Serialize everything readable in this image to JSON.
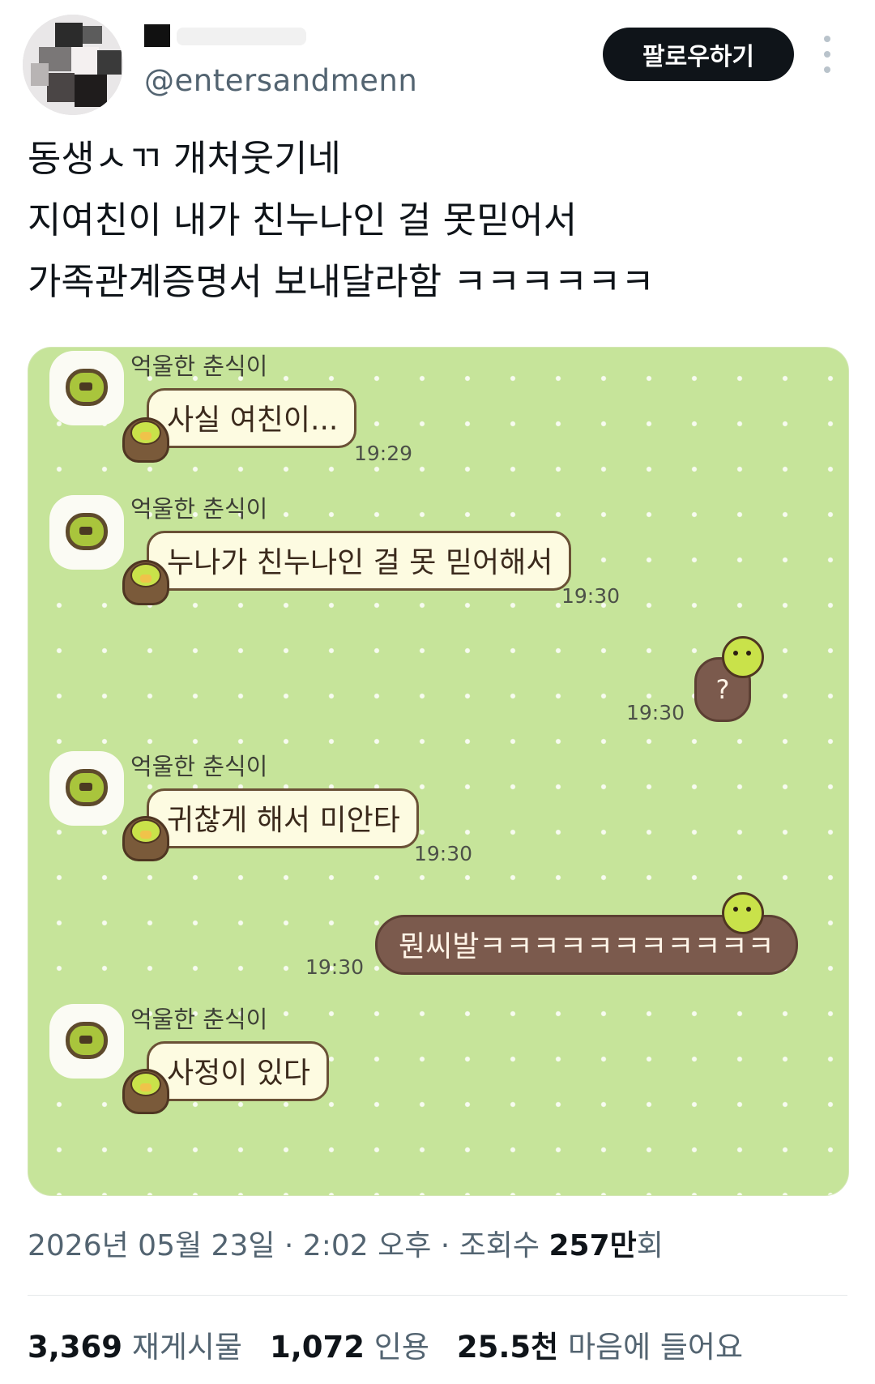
{
  "header": {
    "handle": "@entersandmenn",
    "follow_label": "팔로우하기"
  },
  "tweet": {
    "lines": [
      "동생ㅅㄲ 개처웃기네",
      "지여친이 내가 친누나인 걸 못믿어서",
      "가족관계증명서 보내달라함 ㅋㅋㅋㅋㅋㅋ"
    ]
  },
  "chat": {
    "messages": [
      {
        "sender": "억울한 춘식이",
        "text": "사실 여친이...",
        "time": "19:29"
      },
      {
        "sender": "억울한 춘식이",
        "text": "누나가 친누나인 걸 못 믿어해서",
        "time": "19:30"
      },
      {
        "sender": "me",
        "text": "?",
        "time": "19:30"
      },
      {
        "sender": "억울한 춘식이",
        "text": "귀찮게 해서 미안타",
        "time": "19:30"
      },
      {
        "sender": "me",
        "text": "뭔씨발ㅋㅋㅋㅋㅋㅋㅋㅋㅋㅋㅋ",
        "time": "19:30"
      },
      {
        "sender": "억울한 춘식이",
        "text": "사정이 있다",
        "time": ""
      }
    ]
  },
  "meta": {
    "date_time": "2026년 05월 23일 · 2:02 오후 · 조회수 ",
    "views": "257만",
    "views_suffix": "회"
  },
  "stats": {
    "retweets_count": "3,369",
    "retweets_label": "재게시물",
    "quotes_count": "1,072",
    "quotes_label": "인용",
    "likes_count": "25.5천",
    "likes_label": "마음에 들어요"
  }
}
